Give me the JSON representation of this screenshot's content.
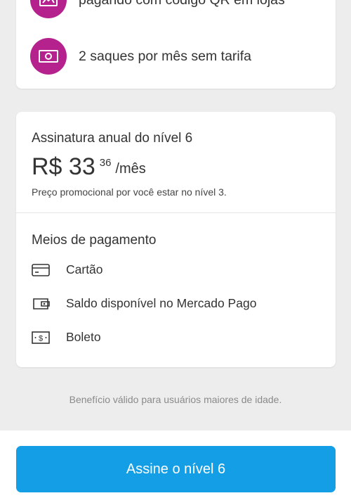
{
  "benefits": {
    "items": [
      {
        "icon": "qr-store-icon",
        "label": "pagando com código QR em lojas"
      },
      {
        "icon": "cash-icon",
        "label": "2 saques por mês sem tarifa"
      }
    ],
    "icon_color": "#b5228d"
  },
  "plan": {
    "title": "Assinatura anual do nível 6",
    "price_main": "R$ 33",
    "price_cents": "36",
    "price_period": "/mês",
    "promo_note": "Preço promocional por você estar no nível 3."
  },
  "payment": {
    "title": "Meios de pagamento",
    "methods": [
      {
        "icon": "credit-card-icon",
        "label": "Cartão"
      },
      {
        "icon": "wallet-icon",
        "label": "Saldo disponível no Mercado Pago"
      },
      {
        "icon": "boleto-icon",
        "label": "Boleto"
      }
    ]
  },
  "footnote": "Benefício válido para usuários maiores de idade.",
  "cta": {
    "label": "Assine o nível 6",
    "color": "#139ee6"
  }
}
